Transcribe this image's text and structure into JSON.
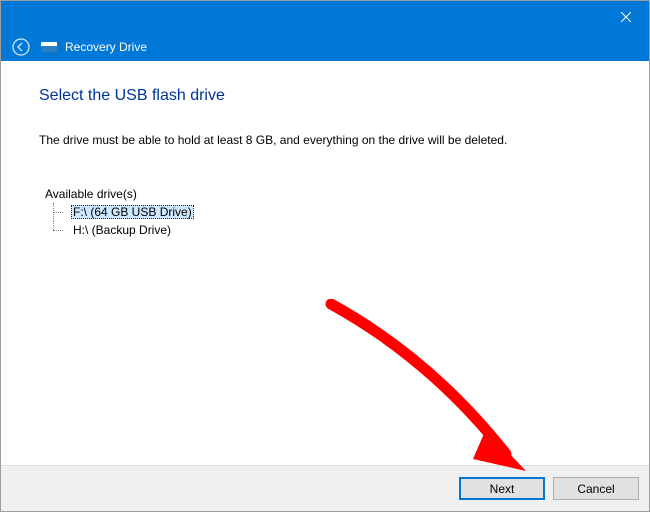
{
  "window": {
    "title": "Recovery Drive"
  },
  "page": {
    "heading": "Select the USB flash drive",
    "description": "The drive must be able to hold at least 8 GB, and everything on the drive will be deleted."
  },
  "drives": {
    "label": "Available drive(s)",
    "items": [
      {
        "label": "F:\\ (64 GB USB Drive)",
        "selected": true
      },
      {
        "label": "H:\\ (Backup Drive)",
        "selected": false
      }
    ]
  },
  "buttons": {
    "next": "Next",
    "cancel": "Cancel"
  }
}
